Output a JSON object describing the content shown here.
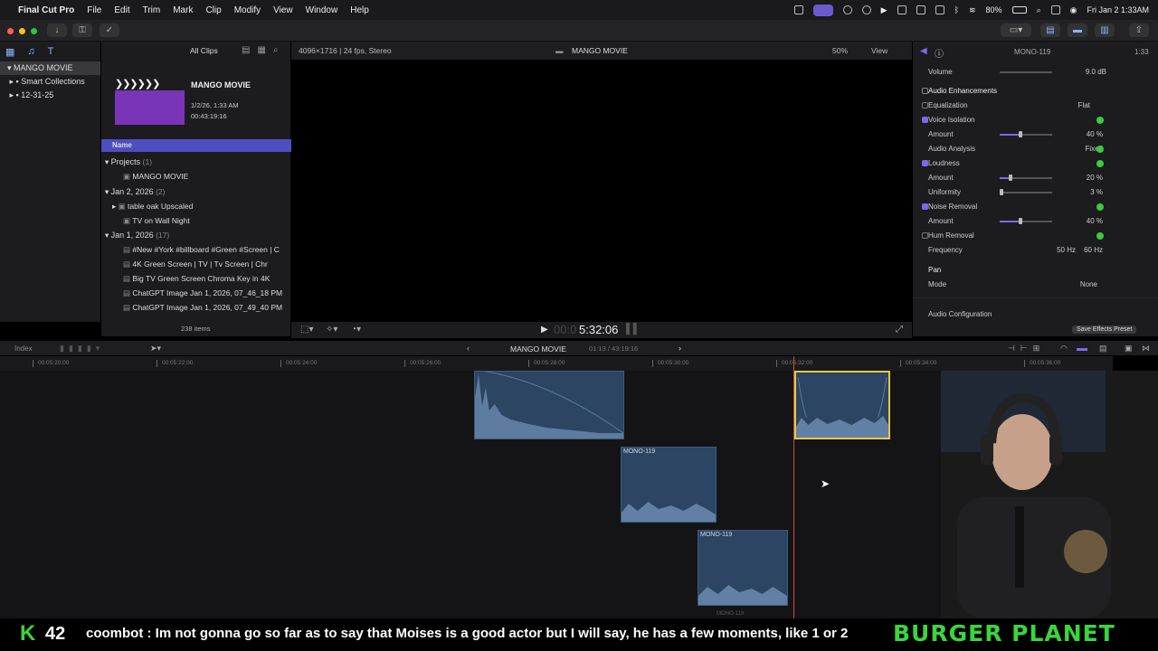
{
  "menubar": {
    "app": "Final Cut Pro",
    "items": [
      "File",
      "Edit",
      "Trim",
      "Mark",
      "Clip",
      "Modify",
      "View",
      "Window",
      "Help"
    ],
    "battery": "80%",
    "clock": "Fri Jan 2  1:33AM"
  },
  "library": {
    "items": [
      "MANGO MOVIE",
      "Smart Collections",
      "12-31-25"
    ]
  },
  "browser": {
    "filter": "All Clips",
    "project_title": "MANGO MOVIE",
    "project_date": "1/2/26, 1:33 AM",
    "project_duration": "00:43:19:16",
    "column_header": "Name",
    "rows": [
      {
        "label": "Projects",
        "count": "(1)"
      },
      {
        "label": "MANGO MOVIE"
      },
      {
        "label": "Jan 2, 2026",
        "count": "(2)"
      },
      {
        "label": "table oak Upscaled"
      },
      {
        "label": "TV on Wall Night"
      },
      {
        "label": "Jan 1, 2026",
        "count": "(17)"
      },
      {
        "label": "#New #York #billboard #Green #Screen | C"
      },
      {
        "label": "4K Green Screen  |  TV  |  Tv Screen  |  Chr"
      },
      {
        "label": "Big TV Green Screen Chroma Key in 4K"
      },
      {
        "label": "ChatGPT Image Jan 1, 2026, 07_46_18 PM"
      },
      {
        "label": "ChatGPT Image Jan 1, 2026, 07_49_40 PM"
      }
    ],
    "item_count": "238 items"
  },
  "viewer": {
    "format": "4096×1716 | 24 fps, Stereo",
    "title": "MANGO MOVIE",
    "zoom": "50%",
    "view_menu": "View",
    "timecode": "5:32:06"
  },
  "inspector": {
    "clip_name": "MONO-119",
    "clip_time": "1:33",
    "volume_label": "Volume",
    "volume_value": "9.0 dB",
    "section": "Audio Enhancements",
    "rows": [
      {
        "label": "Equalization",
        "value": "Flat",
        "checked": false
      },
      {
        "label": "Voice Isolation",
        "checked": true
      },
      {
        "label": "Amount",
        "value": "40 %",
        "level": 0.4
      },
      {
        "label": "Audio Analysis",
        "value": "Fixed"
      },
      {
        "label": "Loudness",
        "checked": true
      },
      {
        "label": "Amount",
        "value": "20 %",
        "level": 0.2
      },
      {
        "label": "Uniformity",
        "value": "3 %",
        "level": 0.03
      },
      {
        "label": "Noise Removal",
        "checked": true
      },
      {
        "label": "Amount",
        "value": "40 %",
        "level": 0.4
      },
      {
        "label": "Hum Removal",
        "checked": false
      },
      {
        "label": "Frequency",
        "value": "50 Hz",
        "value2": "60 Hz"
      }
    ],
    "pan_label": "Pan",
    "mode_label": "Mode",
    "mode_value": "None",
    "audio_config": "Audio Configuration",
    "save_preset": "Save Effects Preset"
  },
  "timeline": {
    "index_label": "Index",
    "project_title": "MANGO MOVIE",
    "timecode": "01:13 / 43:19:16",
    "ruler_ticks": [
      "00:05:20:00",
      "00:05:22:00",
      "00:05:24:00",
      "00:05:26:00",
      "00:05:28:00",
      "00:05:30:00",
      "00:05:32:00",
      "00:05:34:00",
      "00:05:36:00"
    ],
    "clip_labels": [
      "MONO-119",
      "MONO-119",
      "MONO-119"
    ]
  },
  "overlay": {
    "chat_count": "42",
    "chat_text": "coombot : Im not gonna go so far as to say that Moises is a good actor but I will say, he has a few moments, like 1 or 2",
    "banner": "BURGER PLANET"
  },
  "colors": {
    "accent": "#6a5acd",
    "clip": "#2b4562",
    "selected_clip_border": "#e6c84a",
    "banner": "#39d63b"
  }
}
